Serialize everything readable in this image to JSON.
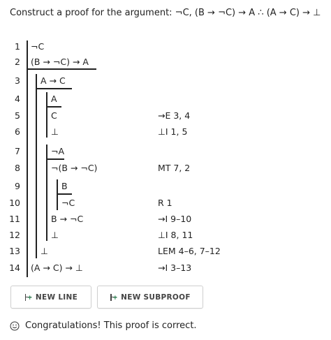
{
  "problem": {
    "text": "Construct a proof for the argument: ¬C, (B → ¬C) → A ∴ (A → C) → ⊥"
  },
  "proof": {
    "lines": [
      {
        "num": "1",
        "formula": "¬C",
        "justification": ""
      },
      {
        "num": "2",
        "formula": "(B → ¬C) → A",
        "justification": ""
      },
      {
        "num": "3",
        "formula": "A → C",
        "justification": ""
      },
      {
        "num": "4",
        "formula": "A",
        "justification": ""
      },
      {
        "num": "5",
        "formula": "C",
        "justification": "→E 3, 4"
      },
      {
        "num": "6",
        "formula": "⊥",
        "justification": "⊥I 1, 5"
      },
      {
        "num": "7",
        "formula": "¬A",
        "justification": ""
      },
      {
        "num": "8",
        "formula": "¬(B → ¬C)",
        "justification": "MT 7, 2"
      },
      {
        "num": "9",
        "formula": "B",
        "justification": ""
      },
      {
        "num": "10",
        "formula": "¬C",
        "justification": "R 1"
      },
      {
        "num": "11",
        "formula": "B → ¬C",
        "justification": "→I 9–10"
      },
      {
        "num": "12",
        "formula": "⊥",
        "justification": "⊥I 8, 11"
      },
      {
        "num": "13",
        "formula": "⊥",
        "justification": "LEM 4–6, 7–12"
      },
      {
        "num": "14",
        "formula": "(A → C) → ⊥",
        "justification": "→I 3–13"
      }
    ]
  },
  "buttons": {
    "new_line": "NEW LINE",
    "new_subproof": "NEW SUBPROOF"
  },
  "status": {
    "message": "Congratulations! This proof is correct."
  },
  "colors": {
    "text": "#222222",
    "button_border": "#cfcfcf",
    "plus_green": "#2e8b57"
  },
  "icons": [
    "new-line-icon",
    "new-subproof-icon",
    "smiley-icon"
  ]
}
